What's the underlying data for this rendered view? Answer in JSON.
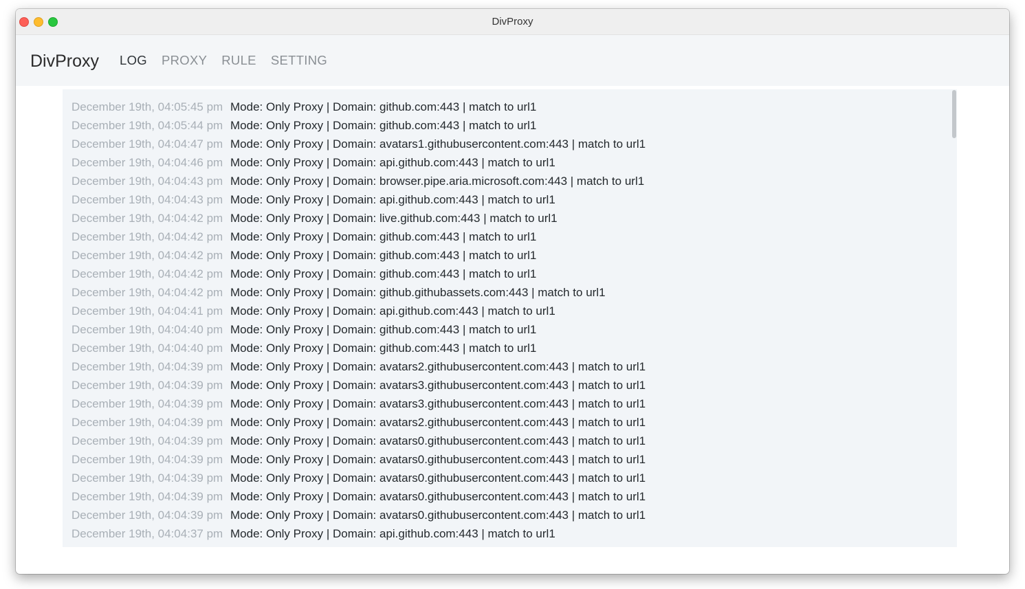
{
  "window": {
    "title": "DivProxy"
  },
  "navbar": {
    "brand": "DivProxy",
    "items": [
      {
        "label": "LOG",
        "active": true
      },
      {
        "label": "PROXY",
        "active": false
      },
      {
        "label": "RULE",
        "active": false
      },
      {
        "label": "SETTING",
        "active": false
      }
    ]
  },
  "logs": [
    {
      "time": "December 19th, 04:05:45 pm",
      "message": "Mode: Only Proxy | Domain: github.com:443 | match to url1"
    },
    {
      "time": "December 19th, 04:05:44 pm",
      "message": "Mode: Only Proxy | Domain: github.com:443 | match to url1"
    },
    {
      "time": "December 19th, 04:04:47 pm",
      "message": "Mode: Only Proxy | Domain: avatars1.githubusercontent.com:443 | match to url1"
    },
    {
      "time": "December 19th, 04:04:46 pm",
      "message": "Mode: Only Proxy | Domain: api.github.com:443 | match to url1"
    },
    {
      "time": "December 19th, 04:04:43 pm",
      "message": "Mode: Only Proxy | Domain: browser.pipe.aria.microsoft.com:443 | match to url1"
    },
    {
      "time": "December 19th, 04:04:43 pm",
      "message": "Mode: Only Proxy | Domain: api.github.com:443 | match to url1"
    },
    {
      "time": "December 19th, 04:04:42 pm",
      "message": "Mode: Only Proxy | Domain: live.github.com:443 | match to url1"
    },
    {
      "time": "December 19th, 04:04:42 pm",
      "message": "Mode: Only Proxy | Domain: github.com:443 | match to url1"
    },
    {
      "time": "December 19th, 04:04:42 pm",
      "message": "Mode: Only Proxy | Domain: github.com:443 | match to url1"
    },
    {
      "time": "December 19th, 04:04:42 pm",
      "message": "Mode: Only Proxy | Domain: github.com:443 | match to url1"
    },
    {
      "time": "December 19th, 04:04:42 pm",
      "message": "Mode: Only Proxy | Domain: github.githubassets.com:443 | match to url1"
    },
    {
      "time": "December 19th, 04:04:41 pm",
      "message": "Mode: Only Proxy | Domain: api.github.com:443 | match to url1"
    },
    {
      "time": "December 19th, 04:04:40 pm",
      "message": "Mode: Only Proxy | Domain: github.com:443 | match to url1"
    },
    {
      "time": "December 19th, 04:04:40 pm",
      "message": "Mode: Only Proxy | Domain: github.com:443 | match to url1"
    },
    {
      "time": "December 19th, 04:04:39 pm",
      "message": "Mode: Only Proxy | Domain: avatars2.githubusercontent.com:443 | match to url1"
    },
    {
      "time": "December 19th, 04:04:39 pm",
      "message": "Mode: Only Proxy | Domain: avatars3.githubusercontent.com:443 | match to url1"
    },
    {
      "time": "December 19th, 04:04:39 pm",
      "message": "Mode: Only Proxy | Domain: avatars3.githubusercontent.com:443 | match to url1"
    },
    {
      "time": "December 19th, 04:04:39 pm",
      "message": "Mode: Only Proxy | Domain: avatars2.githubusercontent.com:443 | match to url1"
    },
    {
      "time": "December 19th, 04:04:39 pm",
      "message": "Mode: Only Proxy | Domain: avatars0.githubusercontent.com:443 | match to url1"
    },
    {
      "time": "December 19th, 04:04:39 pm",
      "message": "Mode: Only Proxy | Domain: avatars0.githubusercontent.com:443 | match to url1"
    },
    {
      "time": "December 19th, 04:04:39 pm",
      "message": "Mode: Only Proxy | Domain: avatars0.githubusercontent.com:443 | match to url1"
    },
    {
      "time": "December 19th, 04:04:39 pm",
      "message": "Mode: Only Proxy | Domain: avatars0.githubusercontent.com:443 | match to url1"
    },
    {
      "time": "December 19th, 04:04:39 pm",
      "message": "Mode: Only Proxy | Domain: avatars0.githubusercontent.com:443 | match to url1"
    },
    {
      "time": "December 19th, 04:04:37 pm",
      "message": "Mode: Only Proxy | Domain: api.github.com:443 | match to url1"
    }
  ]
}
